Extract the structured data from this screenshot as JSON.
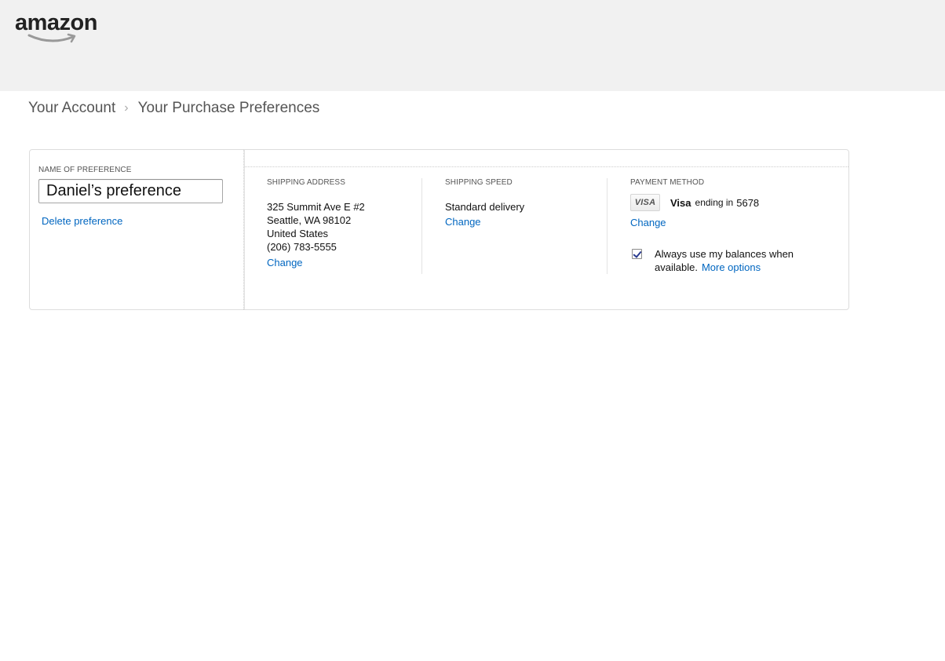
{
  "header": {
    "logo_text": "amazon"
  },
  "breadcrumb": {
    "items": [
      "Your Account",
      "Your Purchase Preferences"
    ],
    "separator": "›"
  },
  "preference": {
    "name_label": "NAME OF PREFERENCE",
    "name_value": "Daniel’s preference",
    "delete_label": "Delete preference"
  },
  "shipping_address": {
    "label": "SHIPPING ADDRESS",
    "line1": "325 Summit Ave E #2",
    "line2": "Seattle, WA 98102",
    "line3": "United States",
    "phone": "(206) 783-5555",
    "change_label": "Change"
  },
  "shipping_speed": {
    "label": "SHIPPING SPEED",
    "value": "Standard delivery",
    "change_label": "Change"
  },
  "payment": {
    "label": "PAYMENT METHOD",
    "badge_text": "VISA",
    "brand": "Visa",
    "ending_text": "ending in",
    "last4": "5678",
    "change_label": "Change",
    "balances_checked": true,
    "balances_text": "Always use my balances when available.",
    "more_options_label": "More options"
  },
  "colors": {
    "link": "#0066c0",
    "header_bg": "#f1f1f1",
    "logo_smile": "#999999"
  }
}
